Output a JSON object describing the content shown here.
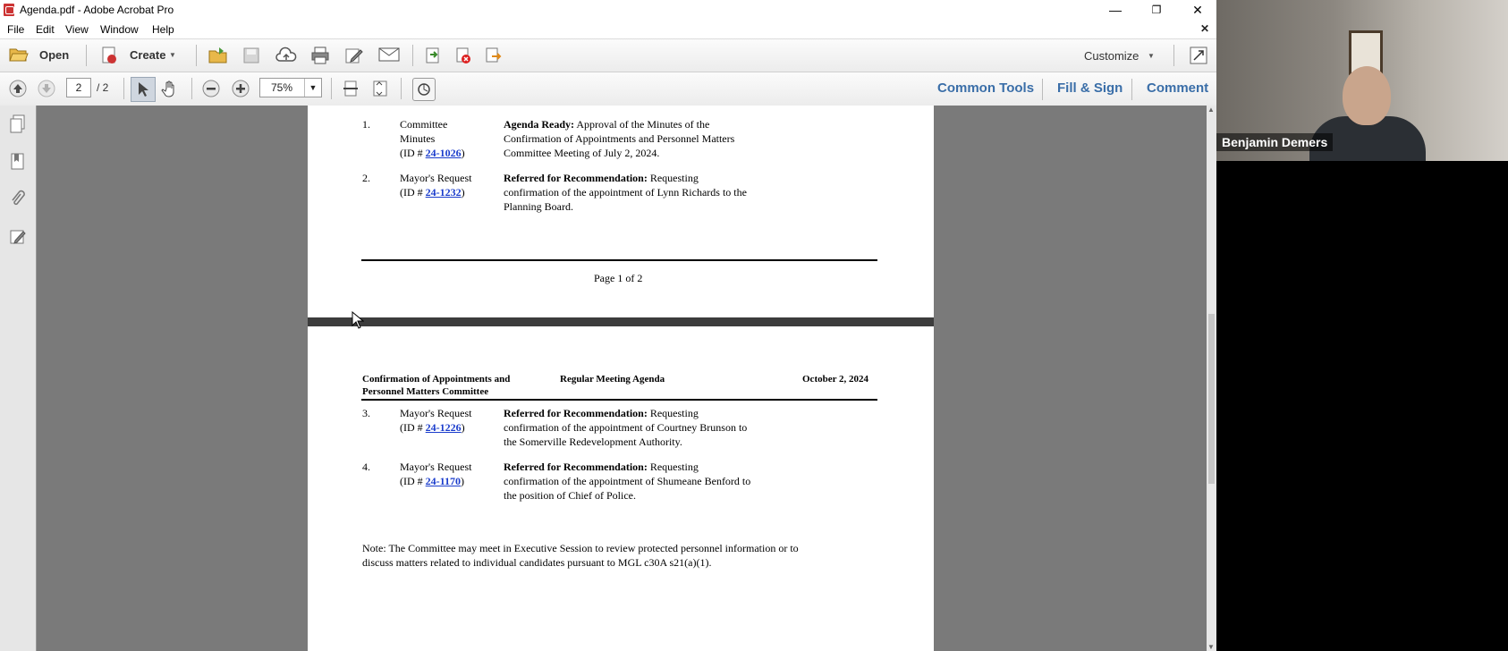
{
  "window": {
    "title": "Agenda.pdf - Adobe Acrobat Pro",
    "menu": [
      "File",
      "Edit",
      "View",
      "Window",
      "Help"
    ]
  },
  "toolbar": {
    "open_label": "Open",
    "create_label": "Create",
    "customize_label": "Customize",
    "page_current": "2",
    "page_total": "/ 2",
    "zoom": "75%",
    "right_tools": [
      "Common Tools",
      "Fill & Sign",
      "Comment"
    ]
  },
  "page1": {
    "items": [
      {
        "num": "1.",
        "type_lines": [
          "Committee",
          "Minutes"
        ],
        "id_prefix": "(ID # ",
        "id": "24-1026",
        "id_suffix": ")",
        "status": "Agenda Ready:",
        "desc_lines": [
          " Approval of the Minutes of the",
          "Confirmation of Appointments and Personnel Matters",
          "Committee Meeting of July 2, 2024."
        ]
      },
      {
        "num": "2.",
        "type_lines": [
          "Mayor's Request"
        ],
        "id_prefix": "(ID # ",
        "id": "24-1232",
        "id_suffix": ")",
        "status": "Referred for Recommendation:",
        "desc_lines": [
          " Requesting",
          "confirmation of the appointment of Lynn Richards to the",
          "Planning Board."
        ]
      }
    ],
    "footer": "Page 1 of 2"
  },
  "page2": {
    "header_left": [
      "Confirmation of Appointments and",
      "Personnel Matters Committee"
    ],
    "header_center": "Regular Meeting Agenda",
    "header_right": "October 2, 2024",
    "items": [
      {
        "num": "3.",
        "type_lines": [
          "Mayor's Request"
        ],
        "id_prefix": "(ID # ",
        "id": "24-1226",
        "id_suffix": ")",
        "status": "Referred for Recommendation:",
        "desc_lines": [
          " Requesting",
          "confirmation of the appointment of Courtney Brunson to",
          "the Somerville Redevelopment Authority."
        ]
      },
      {
        "num": "4.",
        "type_lines": [
          "Mayor's Request"
        ],
        "id_prefix": "(ID # ",
        "id": "24-1170",
        "id_suffix": ")",
        "status": "Referred for Recommendation:",
        "desc_lines": [
          " Requesting",
          "confirmation of the appointment of Shumeane Benford to",
          "the position of Chief of Police."
        ]
      }
    ],
    "note_lines": [
      "Note: The Committee may meet in Executive Session to review protected personnel information or to",
      "discuss matters related to individual candidates pursuant to MGL c30A s21(a)(1)."
    ]
  },
  "video": {
    "participant_name": "Benjamin Demers"
  },
  "colors": {
    "accent": "#3a6ea8",
    "link": "#1a3ccc",
    "viewer_bg": "#7a7a7a"
  }
}
